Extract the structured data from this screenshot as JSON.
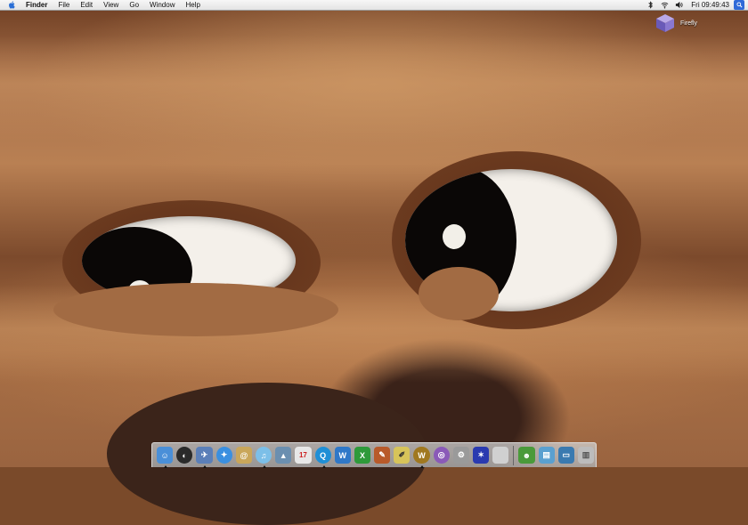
{
  "menubar": {
    "app_name": "Finder",
    "menus": [
      "File",
      "Edit",
      "View",
      "Go",
      "Window",
      "Help"
    ],
    "clock": "Fri 09:49:43",
    "status_icons": [
      "bluetooth-icon",
      "wifi-icon",
      "volume-icon"
    ]
  },
  "desktop": {
    "items": [
      {
        "label": "Firefly",
        "icon": "cube-icon"
      }
    ]
  },
  "dock": {
    "apps": [
      {
        "name": "finder-icon",
        "color": "#4a8fd8",
        "glyph": "☺"
      },
      {
        "name": "dashboard-icon",
        "color": "#2a2a2a",
        "glyph": "◐"
      },
      {
        "name": "mail-icon",
        "color": "#5b7fb8",
        "glyph": "✈"
      },
      {
        "name": "safari-icon",
        "color": "#3a8fe0",
        "glyph": "✦"
      },
      {
        "name": "address-book-icon",
        "color": "#c9a65a",
        "glyph": "@"
      },
      {
        "name": "itunes-icon",
        "color": "#7cbfe8",
        "glyph": "♫"
      },
      {
        "name": "iphoto-icon",
        "color": "#6b8fb0",
        "glyph": "▲"
      },
      {
        "name": "ical-icon",
        "color": "#e8e8e8",
        "glyph": "17"
      },
      {
        "name": "quicktime-icon",
        "color": "#1f8fd6",
        "glyph": "Q"
      },
      {
        "name": "word-icon",
        "color": "#2f78c8",
        "glyph": "W"
      },
      {
        "name": "excel-icon",
        "color": "#2e9a3a",
        "glyph": "X"
      },
      {
        "name": "script-editor-icon",
        "color": "#b85a2a",
        "glyph": "✎"
      },
      {
        "name": "textedit-icon",
        "color": "#d7c45a",
        "glyph": "✐"
      },
      {
        "name": "warcraft-icon",
        "color": "#a07820",
        "glyph": "W"
      },
      {
        "name": "itunes-purple-icon",
        "color": "#8a5ab8",
        "glyph": "◎"
      },
      {
        "name": "utility-icon",
        "color": "#9a9a9a",
        "glyph": "⚙"
      },
      {
        "name": "wizard-icon",
        "color": "#2a3ab0",
        "glyph": "✶"
      },
      {
        "name": "apple-store-icon",
        "color": "#d0d0d0",
        "glyph": ""
      }
    ],
    "docs": [
      {
        "name": "frog-icon",
        "color": "#4a9a3a",
        "glyph": "☻"
      },
      {
        "name": "documents-folder-icon",
        "color": "#5aa0d0",
        "glyph": "▤"
      },
      {
        "name": "desktop-folder-icon",
        "color": "#3a7ab0",
        "glyph": "▭"
      },
      {
        "name": "trash-icon",
        "color": "#bcbcbc",
        "glyph": "▥"
      }
    ]
  }
}
